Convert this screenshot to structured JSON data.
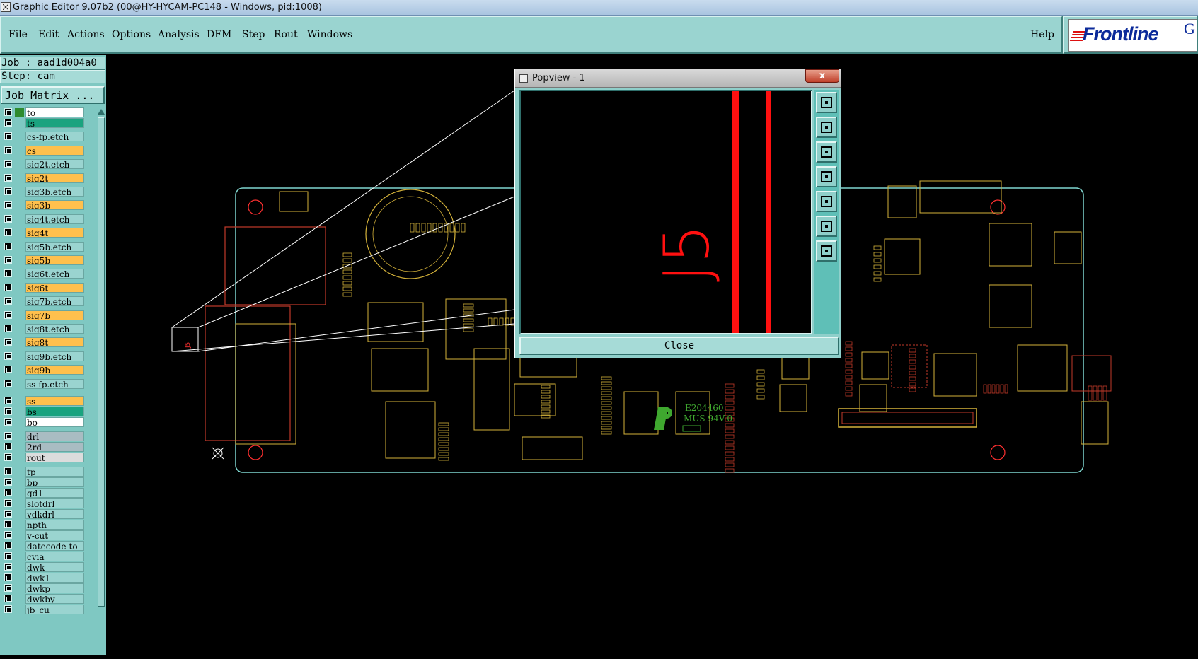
{
  "window": {
    "title": "Graphic Editor 9.07b2 (00@HY-HYCAM-PC148 - Windows, pid:1008)"
  },
  "menubar": {
    "items": [
      "File",
      "Edit",
      "Actions",
      "Options",
      "Analysis",
      "DFM",
      "Step",
      "Rout",
      "Windows"
    ],
    "help": "Help"
  },
  "logo": {
    "text": "Frontline",
    "tail": "G"
  },
  "sidebar": {
    "job": "Job : aad1d004a0",
    "step": "Step: cam",
    "job_matrix_button": "Job Matrix ...",
    "layers": [
      {
        "name": "to",
        "bg": "#ffffff",
        "swatch": "#2e8b2e"
      },
      {
        "name": "ts",
        "bg": "#1aa37f",
        "swatch": null
      },
      {
        "name": "cs-fp.etch",
        "bg": "#9ad4d0",
        "swatch": null
      },
      {
        "name": "cs",
        "bg": "#ffc04d",
        "swatch": null
      },
      {
        "name": "sig2t.etch",
        "bg": "#9ad4d0",
        "swatch": null
      },
      {
        "name": "sig2t",
        "bg": "#ffc04d",
        "swatch": null
      },
      {
        "name": "sig3b.etch",
        "bg": "#9ad4d0",
        "swatch": null
      },
      {
        "name": "sig3b",
        "bg": "#ffc04d",
        "swatch": null
      },
      {
        "name": "sig4t.etch",
        "bg": "#9ad4d0",
        "swatch": null
      },
      {
        "name": "sig4t",
        "bg": "#ffc04d",
        "swatch": null
      },
      {
        "name": "sig5b.etch",
        "bg": "#9ad4d0",
        "swatch": null
      },
      {
        "name": "sig5b",
        "bg": "#ffc04d",
        "swatch": null
      },
      {
        "name": "sig6t.etch",
        "bg": "#9ad4d0",
        "swatch": null
      },
      {
        "name": "sig6t",
        "bg": "#ffc04d",
        "swatch": null
      },
      {
        "name": "sig7b.etch",
        "bg": "#9ad4d0",
        "swatch": null
      },
      {
        "name": "sig7b",
        "bg": "#ffc04d",
        "swatch": null
      },
      {
        "name": "sig8t.etch",
        "bg": "#9ad4d0",
        "swatch": null
      },
      {
        "name": "sig8t",
        "bg": "#ffc04d",
        "swatch": null
      },
      {
        "name": "sig9b.etch",
        "bg": "#9ad4d0",
        "swatch": null
      },
      {
        "name": "sig9b",
        "bg": "#ffc04d",
        "swatch": null
      },
      {
        "name": "ss-fp.etch",
        "bg": "#9ad4d0",
        "swatch": null
      },
      {
        "name": "ss",
        "bg": "#ffc04d",
        "swatch": null
      },
      {
        "name": "bs",
        "bg": "#1aa37f",
        "swatch": null
      },
      {
        "name": "bo",
        "bg": "#ffffff",
        "swatch": null
      },
      {
        "name": "drl",
        "bg": "#a9bcc2",
        "swatch": null
      },
      {
        "name": "2rd",
        "bg": "#a9bcc2",
        "swatch": null
      },
      {
        "name": "rout",
        "bg": "#dcdcdc",
        "swatch": null
      },
      {
        "name": "tp",
        "bg": "#9ad4d0",
        "swatch": null
      },
      {
        "name": "bp",
        "bg": "#9ad4d0",
        "swatch": null
      },
      {
        "name": "gd1",
        "bg": "#9ad4d0",
        "swatch": null
      },
      {
        "name": "slotdrl",
        "bg": "#9ad4d0",
        "swatch": null
      },
      {
        "name": "ydkdrl",
        "bg": "#9ad4d0",
        "swatch": null
      },
      {
        "name": "npth",
        "bg": "#9ad4d0",
        "swatch": null
      },
      {
        "name": "v-cut",
        "bg": "#9ad4d0",
        "swatch": null
      },
      {
        "name": "datecode-to",
        "bg": "#9ad4d0",
        "swatch": null
      },
      {
        "name": "cvia",
        "bg": "#9ad4d0",
        "swatch": null
      },
      {
        "name": "dwk",
        "bg": "#9ad4d0",
        "swatch": null
      },
      {
        "name": "dwk1",
        "bg": "#9ad4d0",
        "swatch": null
      },
      {
        "name": "dwkp",
        "bg": "#9ad4d0",
        "swatch": null
      },
      {
        "name": "dwkby",
        "bg": "#9ad4d0",
        "swatch": null
      },
      {
        "name": "jb_cu",
        "bg": "#9ad4d0",
        "swatch": null
      }
    ]
  },
  "canvas": {
    "board_marking_1": "E204460",
    "board_marking_2": "MUS 94V-0",
    "zoom_label": "J5"
  },
  "popview": {
    "title": "Popview - 1",
    "close_x": "x",
    "close_button": "Close",
    "tools": [
      "zoom-window-icon",
      "pan-up-icon",
      "pan-down-icon",
      "pan-left-icon",
      "pan-right-icon",
      "zoom-fit-icon",
      "zoom-home-icon"
    ]
  },
  "colors": {
    "teal_panel": "#9ad4d0",
    "board_outline": "#7fd6cf",
    "trace_red": "#ff1010",
    "silk_yellow": "#d4b23a"
  }
}
